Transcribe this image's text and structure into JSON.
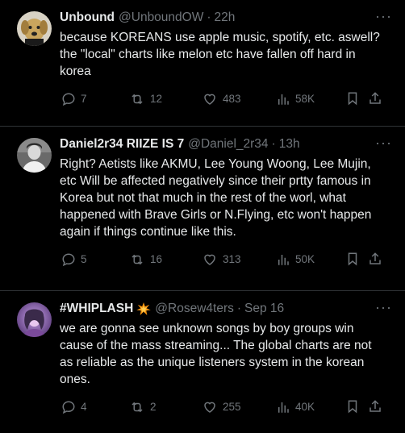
{
  "tweets": [
    {
      "name": "Unbound",
      "handle": "@UnboundOW",
      "separator": "·",
      "time": "22h",
      "text": "because KOREANS use apple music, spotify, etc. aswell? the \"local\" charts like melon etc have fallen off hard in korea",
      "replies": "7",
      "reposts": "12",
      "likes": "483",
      "views": "58K"
    },
    {
      "name": "Daniel2r34 RIIZE IS 7",
      "handle": "@Daniel_2r34",
      "separator": "·",
      "time": "13h",
      "text": "Right? Aetists like AKMU, Lee Young Woong, Lee Mujin, etc Will be affected negatively since their prtty famous in Korea but not that much in the rest of the worl, what happened with Brave Girls or N.Flying, etc won't happen again if things continue like this.",
      "replies": "5",
      "reposts": "16",
      "likes": "313",
      "views": "50K"
    },
    {
      "name": "#WHIPLASH",
      "handle": "@Rosew4ters",
      "separator": "·",
      "time": "Sep 16",
      "text": "we are gonna see unknown songs by boy groups win cause of the mass streaming... The global charts are not as reliable as the unique listeners system in the korean ones.",
      "replies": "4",
      "reposts": "2",
      "likes": "255",
      "views": "40K"
    }
  ],
  "more_glyph": "···",
  "icons": {
    "reply": "speech-bubble-icon",
    "repost": "repost-arrows-icon",
    "like": "heart-icon",
    "views": "bar-chart-icon",
    "bookmark": "bookmark-icon",
    "share": "share-upload-icon",
    "badge": "explosion-emoji-icon"
  },
  "colors": {
    "background": "#000000",
    "text": "#e7e9ea",
    "secondary": "#71767b",
    "divider": "#2f3336"
  }
}
